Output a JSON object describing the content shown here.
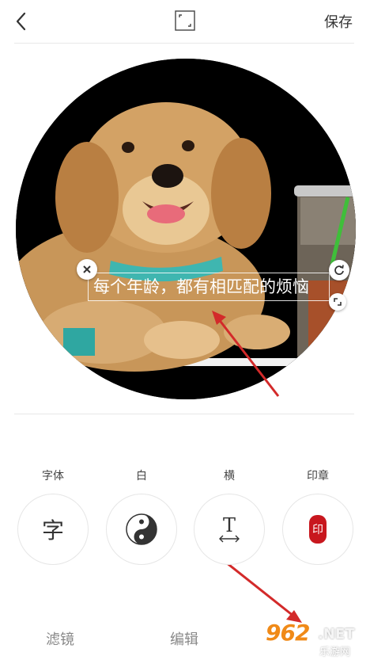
{
  "header": {
    "save_label": "保存"
  },
  "overlay": {
    "caption": "每个年龄，都有相匹配的烦恼"
  },
  "tools": [
    {
      "label": "字体",
      "glyph": "字"
    },
    {
      "label": "白"
    },
    {
      "label": "横",
      "glyph": "T"
    },
    {
      "label": "印章",
      "glyph": "印"
    }
  ],
  "tabs": {
    "filter": "滤镜",
    "edit": "编辑"
  },
  "watermark": {
    "number": "962",
    "suffix": ".NET",
    "subtitle": "乐游网"
  },
  "colors": {
    "arrow": "#d32a2a",
    "seal": "#c8171e",
    "watermark_orange": "#f08a18"
  }
}
